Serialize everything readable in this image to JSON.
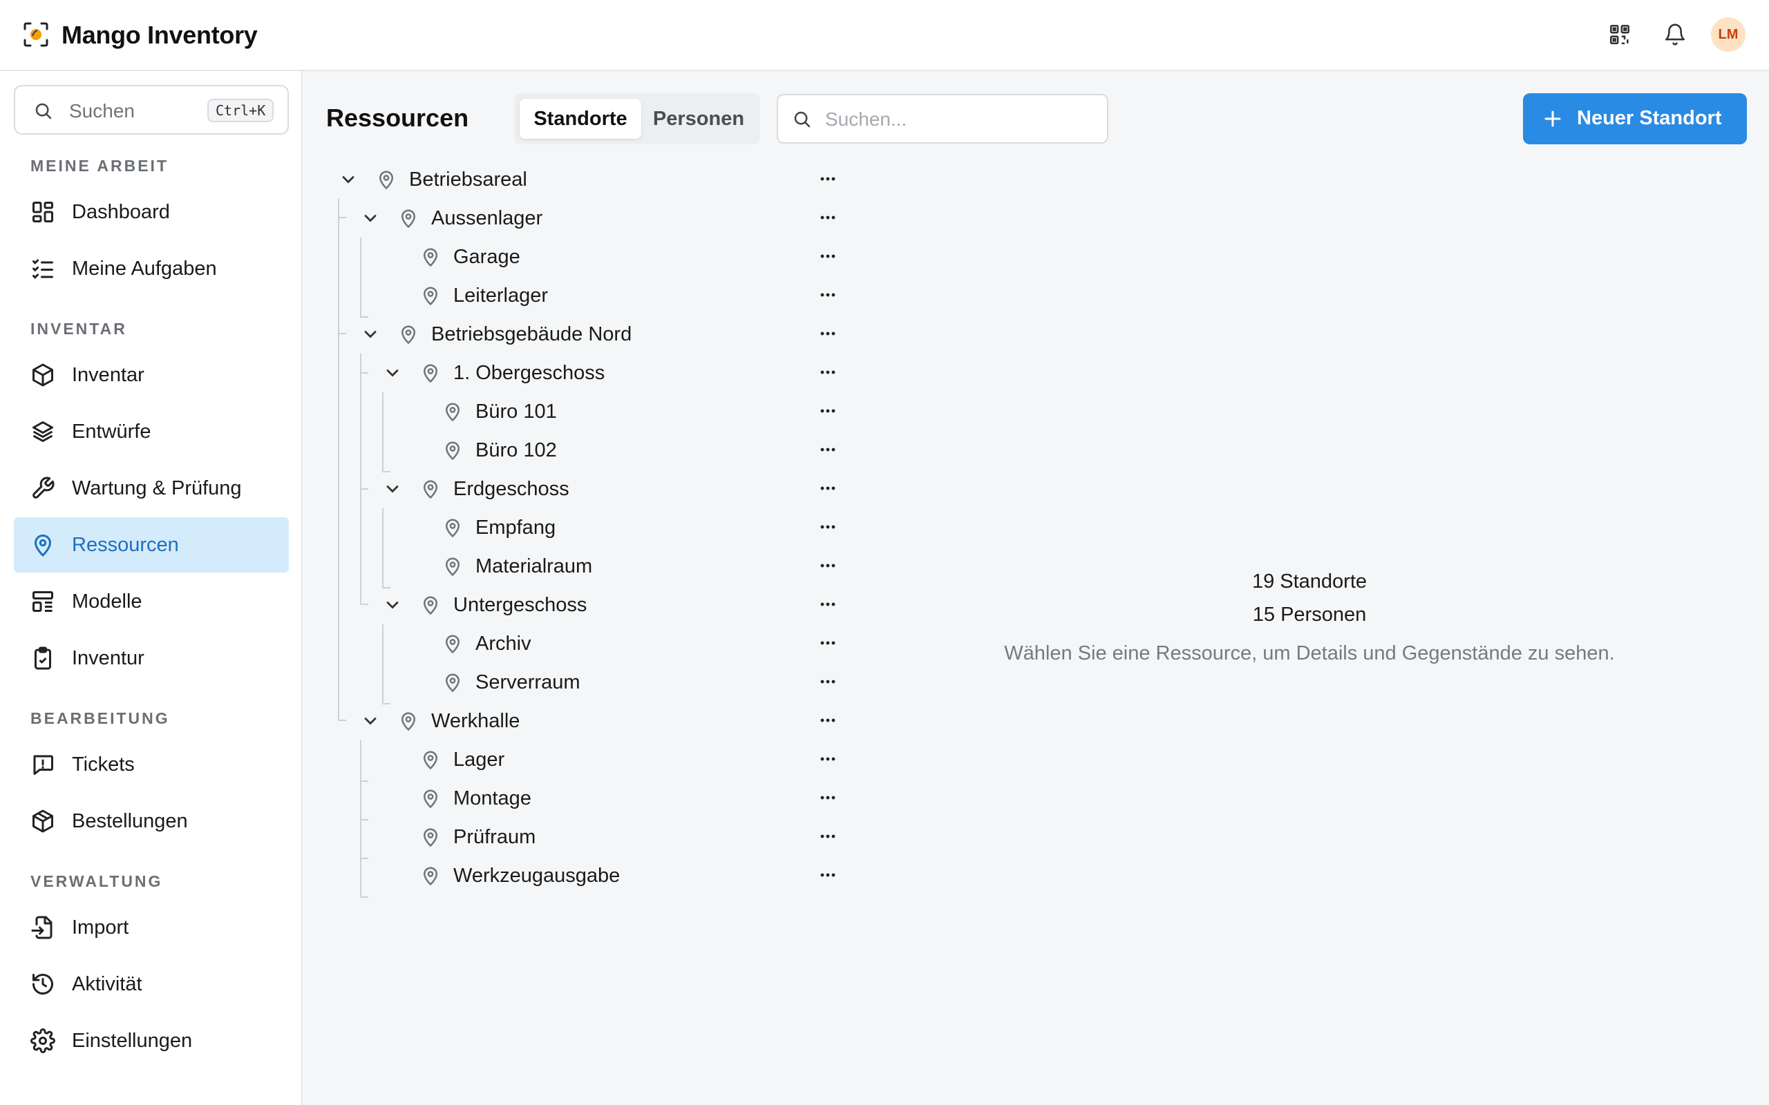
{
  "app": {
    "title": "Mango Inventory",
    "avatar_initials": "LM"
  },
  "topbar_icons": [
    "qr-code-icon",
    "bell-icon"
  ],
  "sidebar": {
    "search": {
      "placeholder": "Suchen",
      "shortcut": "Ctrl+K"
    },
    "sections": [
      {
        "label": "MEINE ARBEIT",
        "items": [
          {
            "label": "Dashboard",
            "icon": "dashboard-grid-icon"
          },
          {
            "label": "Meine Aufgaben",
            "icon": "checklist-icon"
          }
        ]
      },
      {
        "label": "INVENTAR",
        "items": [
          {
            "label": "Inventar",
            "icon": "cube-icon"
          },
          {
            "label": "Entwürfe",
            "icon": "layers-icon"
          },
          {
            "label": "Wartung & Prüfung",
            "icon": "wrench-icon"
          },
          {
            "label": "Ressourcen",
            "icon": "location-pin-icon",
            "active": true
          },
          {
            "label": "Modelle",
            "icon": "model-layout-icon"
          },
          {
            "label": "Inventur",
            "icon": "clipboard-check-icon"
          }
        ]
      },
      {
        "label": "BEARBEITUNG",
        "items": [
          {
            "label": "Tickets",
            "icon": "message-alert-icon"
          },
          {
            "label": "Bestellungen",
            "icon": "package-icon"
          }
        ]
      },
      {
        "label": "VERWALTUNG",
        "items": [
          {
            "label": "Import",
            "icon": "file-import-icon"
          },
          {
            "label": "Aktivität",
            "icon": "history-icon"
          },
          {
            "label": "Einstellungen",
            "icon": "gear-icon"
          }
        ]
      }
    ]
  },
  "main": {
    "title": "Ressourcen",
    "tabs": [
      {
        "label": "Standorte",
        "active": true
      },
      {
        "label": "Personen",
        "active": false
      }
    ],
    "search_placeholder": "Suchen...",
    "primary_button": "Neuer Standort",
    "tree": [
      {
        "label": "Betriebsareal",
        "level": 0,
        "expandable": true
      },
      {
        "label": "Aussenlager",
        "level": 1,
        "expandable": true
      },
      {
        "label": "Garage",
        "level": 2,
        "expandable": false
      },
      {
        "label": "Leiterlager",
        "level": 2,
        "expandable": false
      },
      {
        "label": "Betriebsgebäude Nord",
        "level": 1,
        "expandable": true
      },
      {
        "label": "1. Obergeschoss",
        "level": 2,
        "expandable": true
      },
      {
        "label": "Büro 101",
        "level": 3,
        "expandable": false
      },
      {
        "label": "Büro 102",
        "level": 3,
        "expandable": false
      },
      {
        "label": "Erdgeschoss",
        "level": 2,
        "expandable": true
      },
      {
        "label": "Empfang",
        "level": 3,
        "expandable": false
      },
      {
        "label": "Materialraum",
        "level": 3,
        "expandable": false
      },
      {
        "label": "Untergeschoss",
        "level": 2,
        "expandable": true
      },
      {
        "label": "Archiv",
        "level": 3,
        "expandable": false
      },
      {
        "label": "Serverraum",
        "level": 3,
        "expandable": false
      },
      {
        "label": "Werkhalle",
        "level": 1,
        "expandable": true
      },
      {
        "label": "Lager",
        "level": 2,
        "expandable": false
      },
      {
        "label": "Montage",
        "level": 2,
        "expandable": false
      },
      {
        "label": "Prüfraum",
        "level": 2,
        "expandable": false
      },
      {
        "label": "Werkzeugausgabe",
        "level": 2,
        "expandable": false
      }
    ],
    "empty_state": {
      "count_locations": "19 Standorte",
      "count_people": "15 Personen",
      "hint": "Wählen Sie eine Ressource, um Details und Gegenstände zu sehen."
    }
  },
  "colors": {
    "accent": "#2a8be4",
    "active_bg": "#d4ebfb",
    "active_text": "#1d6fbf",
    "logo_orange": "#f59e0b"
  }
}
